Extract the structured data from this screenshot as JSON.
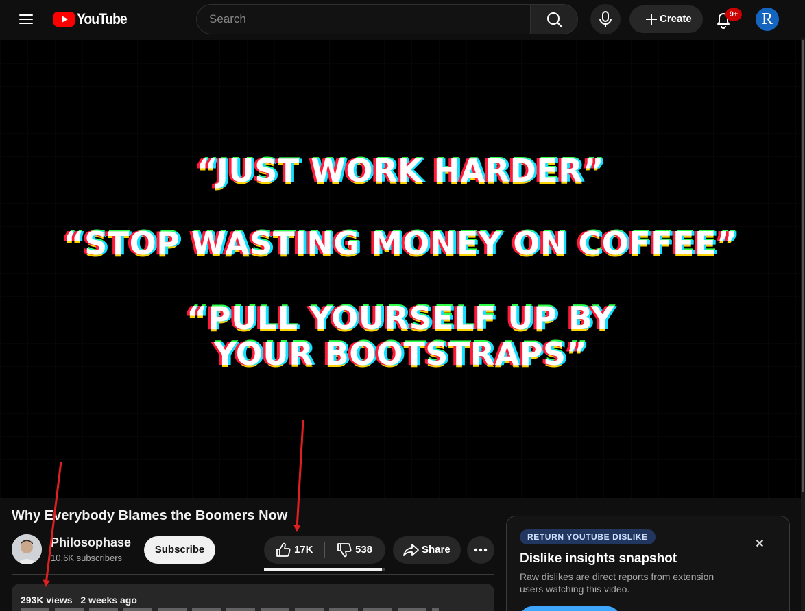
{
  "app": {
    "logo_text": "YouTube"
  },
  "topbar": {
    "search_placeholder": "Search",
    "create_label": "Create",
    "notification_count": "9+",
    "avatar_letter": "R"
  },
  "player": {
    "quotes": [
      "“JUST WORK HARDER”",
      "“STOP WASTING MONEY ON COFFEE”",
      "“PULL YOURSELF UP BY",
      "YOUR BOOTSTRAPS”"
    ]
  },
  "video": {
    "title": "Why Everybody Blames the Boomers Now",
    "channel_name": "Philosophase",
    "channel_subscribers": "10.6K subscribers",
    "subscribe_label": "Subscribe",
    "likes": "17K",
    "dislikes": "538",
    "like_ratio": 0.969,
    "share_label": "Share",
    "views": "293K views",
    "uploaded": "2 weeks ago"
  },
  "extension_panel": {
    "badge": "RETURN YOUTUBE DISLIKE",
    "title": "Dislike insights snapshot",
    "description": "Raw dislikes are direct reports from extension users watching this video."
  },
  "icons": {
    "menu": "hamburger-menu-icon",
    "search": "search-icon",
    "mic": "microphone-icon",
    "create": "plus-icon",
    "notifications": "bell-icon",
    "like": "thumbs-up-icon",
    "dislike": "thumbs-down-icon",
    "share": "share-arrow-icon",
    "more": "more-horizontal-icon",
    "close": "close-icon"
  },
  "colors": {
    "background": "#0f0f0f",
    "brand_red": "#ff0000",
    "notification_badge": "#cc0000",
    "avatar": "#1565c0",
    "annotation_arrow": "#e02020",
    "extension_badge_bg": "#223760",
    "extension_action": "#3ea6ff"
  }
}
